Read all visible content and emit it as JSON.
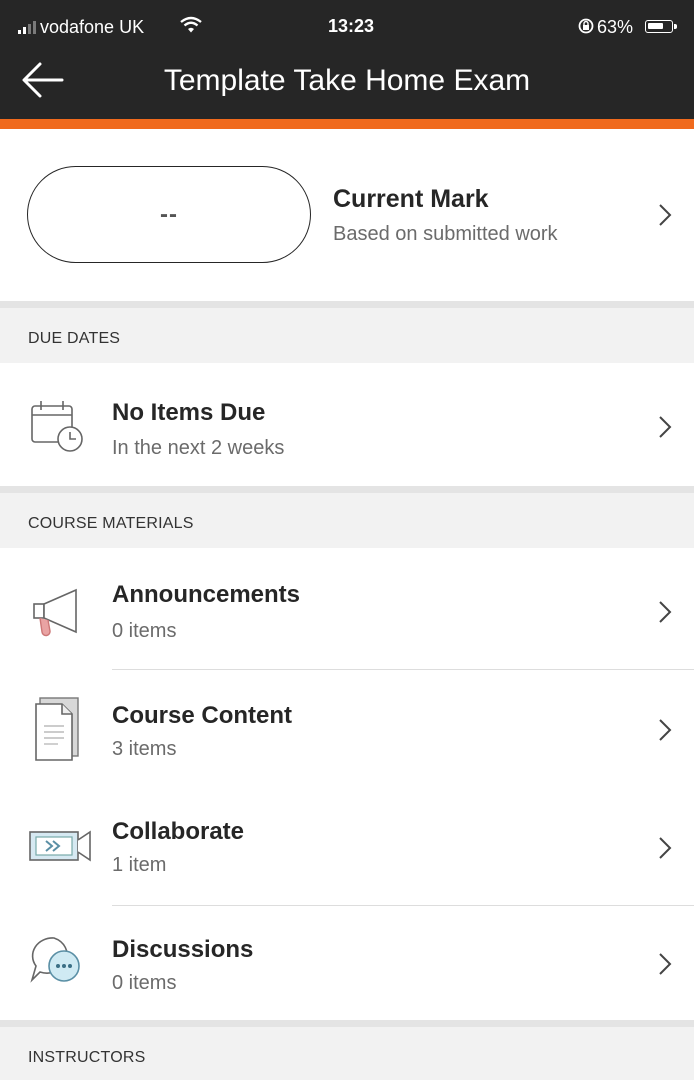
{
  "status_bar": {
    "carrier": "vodafone UK",
    "time": "13:23",
    "battery": "63%"
  },
  "header": {
    "title": "Template Take Home Exam",
    "accent_color": "#f06a1d",
    "bar_color": "#262626"
  },
  "mark": {
    "value": "--",
    "title": "Current Mark",
    "subtitle": "Based on submitted work"
  },
  "sections": {
    "due_dates": {
      "label": "DUE DATES",
      "item": {
        "icon": "calendar-clock-icon",
        "title": "No Items Due",
        "subtitle": "In the next 2 weeks"
      }
    },
    "course_materials": {
      "label": "COURSE MATERIALS",
      "items": [
        {
          "icon": "megaphone-icon",
          "title": "Announcements",
          "subtitle": "0 items"
        },
        {
          "icon": "document-icon",
          "title": "Course Content",
          "subtitle": "3 items"
        },
        {
          "icon": "video-camera-icon",
          "title": "Collaborate",
          "subtitle": "1 item"
        },
        {
          "icon": "chat-bubbles-icon",
          "title": "Discussions",
          "subtitle": "0 items"
        }
      ]
    },
    "instructors": {
      "label": "INSTRUCTORS"
    }
  }
}
